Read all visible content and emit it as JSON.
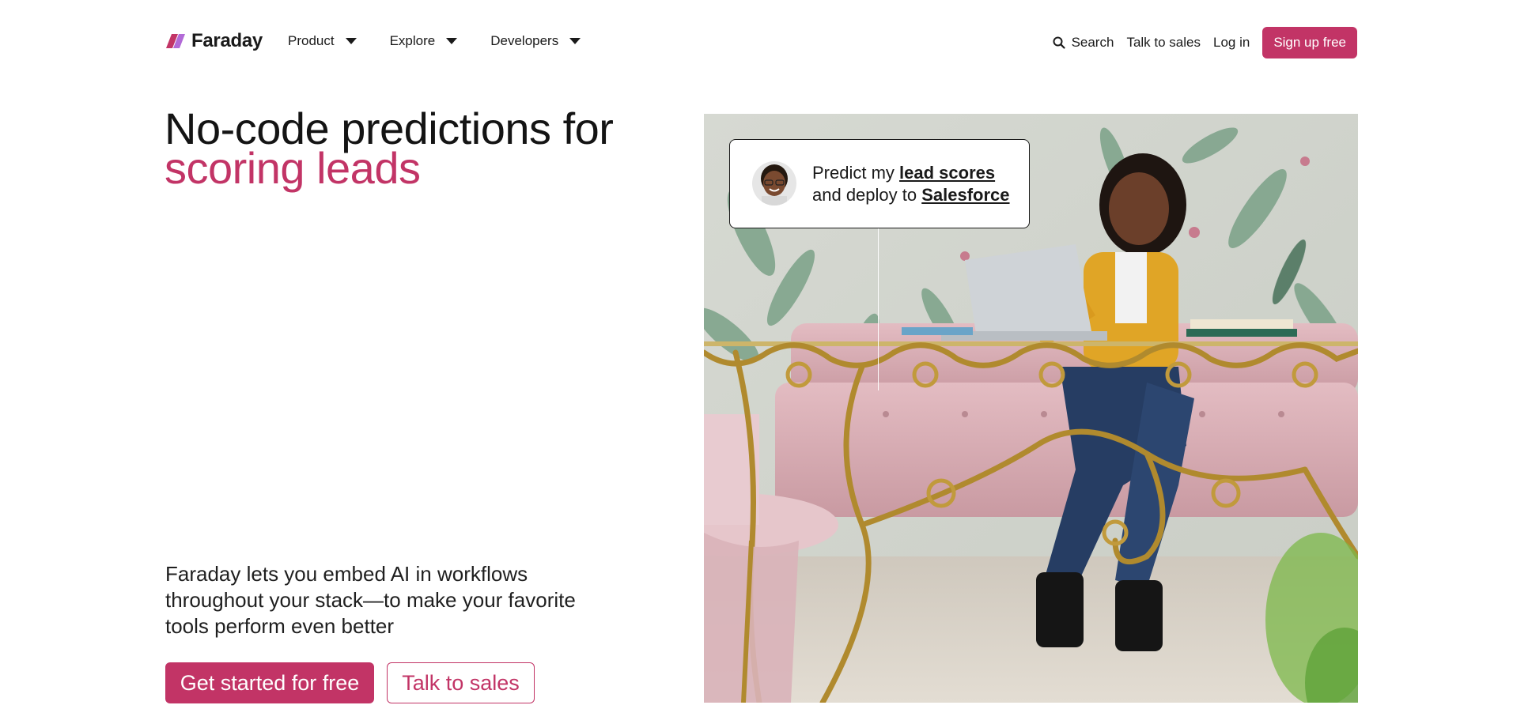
{
  "brand": {
    "name": "Faraday",
    "accent": "#c23466"
  },
  "nav": {
    "items": [
      {
        "label": "Product"
      },
      {
        "label": "Explore"
      },
      {
        "label": "Developers"
      }
    ]
  },
  "utility": {
    "search_label": "Search",
    "talk_label": "Talk to sales",
    "login_label": "Log in",
    "signup_label": "Sign up free"
  },
  "hero": {
    "headline_line1": "No-code predictions for",
    "headline_line2": "scoring leads",
    "subtext": "Faraday lets you embed AI in workflows throughout your stack—to make your favorite tools perform even better",
    "cta_primary": "Get started for free",
    "cta_secondary": "Talk to sales"
  },
  "bubble": {
    "text_a": "Predict my ",
    "link_a": "lead scores",
    "text_b": "and deploy to ",
    "link_b": "Salesforce"
  }
}
